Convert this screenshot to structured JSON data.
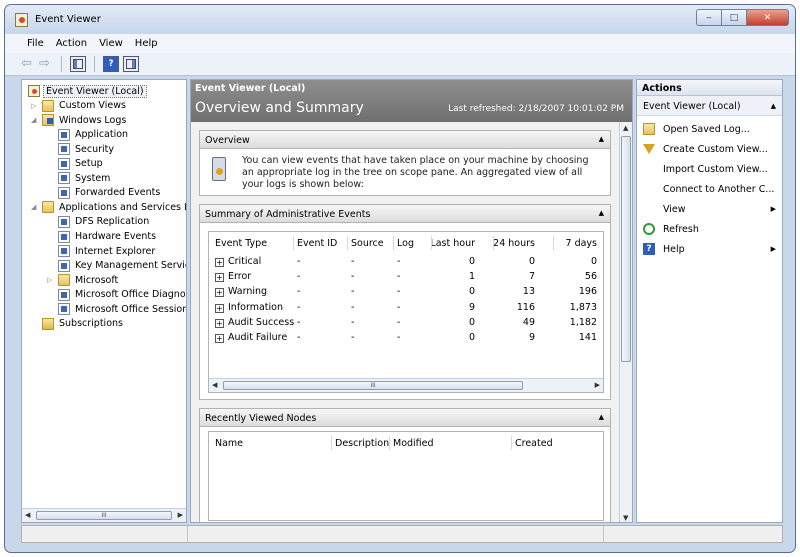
{
  "window": {
    "title": "Event Viewer",
    "controls": {
      "minimize": "‒",
      "maximize": "□",
      "close": "✕"
    }
  },
  "menu": [
    "File",
    "Action",
    "View",
    "Help"
  ],
  "toolbar": {
    "back": "⇦",
    "forward": "⇨",
    "help": "?"
  },
  "tree": [
    {
      "label": "Event Viewer (Local)",
      "icon": "event-viewer-icon",
      "level": 0,
      "selected": true
    },
    {
      "label": "Custom Views",
      "icon": "folder-icon",
      "level": 1,
      "expander": "▷"
    },
    {
      "label": "Windows Logs",
      "icon": "windows-logs-icon",
      "level": 1,
      "expander": "◢"
    },
    {
      "label": "Application",
      "icon": "log-icon",
      "level": 2
    },
    {
      "label": "Security",
      "icon": "log-icon",
      "level": 2
    },
    {
      "label": "Setup",
      "icon": "log-icon",
      "level": 2
    },
    {
      "label": "System",
      "icon": "log-icon",
      "level": 2
    },
    {
      "label": "Forwarded Events",
      "icon": "log-icon",
      "level": 2
    },
    {
      "label": "Applications and Services Logs",
      "icon": "folder-icon",
      "level": 1,
      "expander": "◢"
    },
    {
      "label": "DFS Replication",
      "icon": "log-icon",
      "level": 2
    },
    {
      "label": "Hardware Events",
      "icon": "log-icon",
      "level": 2
    },
    {
      "label": "Internet Explorer",
      "icon": "log-icon",
      "level": 2
    },
    {
      "label": "Key Management Service",
      "icon": "log-icon",
      "level": 2
    },
    {
      "label": "Microsoft",
      "icon": "folder-icon",
      "level": 2,
      "expander": "▷"
    },
    {
      "label": "Microsoft Office Diagnostics",
      "icon": "log-icon",
      "level": 2
    },
    {
      "label": "Microsoft Office Sessions",
      "icon": "log-icon",
      "level": 2
    },
    {
      "label": "Subscriptions",
      "icon": "subscriptions-icon",
      "level": 1
    }
  ],
  "center": {
    "subtitle": "Event Viewer (Local)",
    "title": "Overview and Summary",
    "refreshed": "Last refreshed: 2/18/2007 10:01:02 PM",
    "overview": {
      "header": "Overview",
      "text": "You can view events that have taken place on your machine by choosing an appropriate log in the tree on scope pane. An aggregated view of all your logs is shown below:"
    },
    "summary": {
      "header": "Summary of Administrative Events",
      "columns": [
        "Event Type",
        "Event ID",
        "Source",
        "Log",
        "Last hour",
        "24 hours",
        "7 days"
      ],
      "rows": [
        [
          "Critical",
          "-",
          "-",
          "-",
          "0",
          "0",
          "0"
        ],
        [
          "Error",
          "-",
          "-",
          "-",
          "1",
          "7",
          "56"
        ],
        [
          "Warning",
          "-",
          "-",
          "-",
          "0",
          "13",
          "196"
        ],
        [
          "Information",
          "-",
          "-",
          "-",
          "9",
          "116",
          "1,873"
        ],
        [
          "Audit Success",
          "-",
          "-",
          "-",
          "0",
          "49",
          "1,182"
        ],
        [
          "Audit Failure",
          "-",
          "-",
          "-",
          "0",
          "9",
          "141"
        ]
      ]
    },
    "recent": {
      "header": "Recently Viewed Nodes",
      "columns": [
        "Name",
        "Description",
        "Modified",
        "Created"
      ]
    },
    "scroll_grip": "III",
    "collapse": "▲"
  },
  "actions": {
    "header": "Actions",
    "group": "Event Viewer (Local)",
    "items": [
      {
        "label": "Open Saved Log...",
        "icon": "open-log-icon"
      },
      {
        "label": "Create Custom View...",
        "icon": "filter-icon"
      },
      {
        "label": "Import Custom View...",
        "icon": ""
      },
      {
        "label": "Connect to Another C...",
        "icon": ""
      },
      {
        "label": "View",
        "icon": "",
        "submenu": true
      },
      {
        "label": "Refresh",
        "icon": "refresh-icon"
      },
      {
        "label": "Help",
        "icon": "help-icon",
        "submenu": true
      }
    ]
  }
}
